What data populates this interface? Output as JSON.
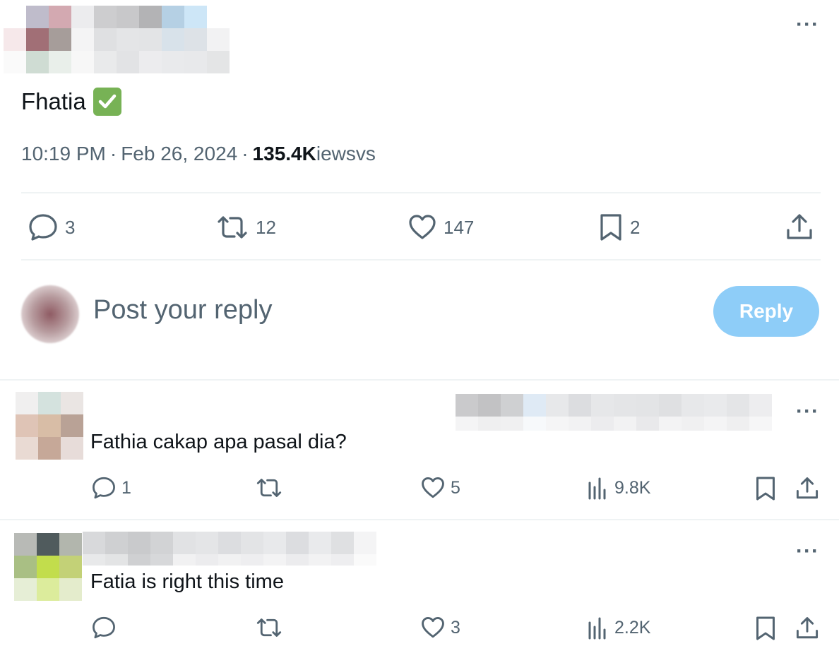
{
  "tweet": {
    "author_name": "Fhatia",
    "verified_emoji": "✅",
    "time": "10:19 PM",
    "date": "Feb 26, 2024",
    "separator": "·",
    "views_count": "135.4K",
    "views_suffix": "iewsvs",
    "more_label": "···",
    "actions": {
      "replies": "3",
      "reposts": "12",
      "likes": "147",
      "bookmarks": "2"
    }
  },
  "compose": {
    "placeholder": "Post your reply",
    "reply_button": "Reply"
  },
  "replies": [
    {
      "text": "Fathia cakap apa pasal dia?",
      "more_label": "···",
      "replies": "1",
      "reposts": "",
      "likes": "5",
      "views": "9.8K"
    },
    {
      "text": "Fatia is right this time",
      "more_label": "···",
      "replies": "",
      "reposts": "",
      "likes": "3",
      "views": "2.2K"
    }
  ],
  "icons": {
    "reply": "reply-icon",
    "repost": "repost-icon",
    "like": "heart-icon",
    "bookmark": "bookmark-icon",
    "share": "share-icon",
    "views": "views-icon",
    "more": "more-icon"
  },
  "colors": {
    "text_primary": "#0f1419",
    "text_secondary": "#536471",
    "reply_button_bg": "#8ecdf8",
    "verified_green": "#77b255",
    "divider": "#eff3f4"
  }
}
